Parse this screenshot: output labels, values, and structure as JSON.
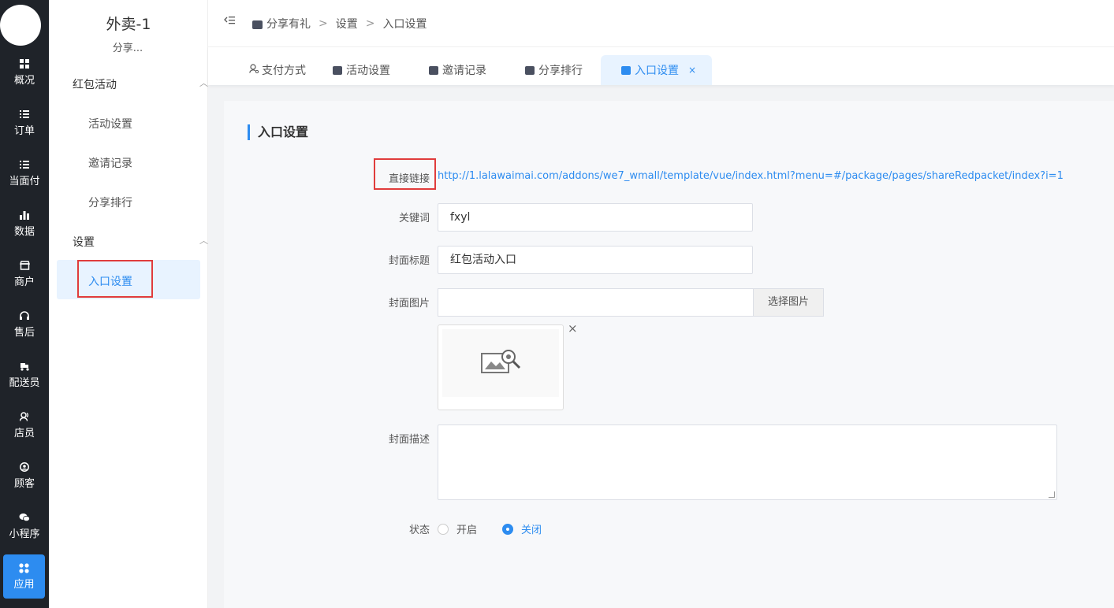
{
  "rail": {
    "items": [
      {
        "label": "概况",
        "icon": "dashboard-icon"
      },
      {
        "label": "订单",
        "icon": "list-icon"
      },
      {
        "label": "当面付",
        "icon": "list-icon"
      },
      {
        "label": "数据",
        "icon": "bar-chart-icon"
      },
      {
        "label": "商户",
        "icon": "store-icon"
      },
      {
        "label": "售后",
        "icon": "headset-icon"
      },
      {
        "label": "配送员",
        "icon": "delivery-icon"
      },
      {
        "label": "店员",
        "icon": "staff-icon"
      },
      {
        "label": "顾客",
        "icon": "customer-icon"
      },
      {
        "label": "小程序",
        "icon": "wechat-icon"
      },
      {
        "label": "应用",
        "icon": "apps-icon"
      }
    ],
    "active": "应用"
  },
  "subnav": {
    "store_name": "外卖-1",
    "store_sub": "分享...",
    "groups": [
      {
        "label": "红包活动",
        "items": [
          "活动设置",
          "邀请记录",
          "分享排行"
        ]
      },
      {
        "label": "设置",
        "items": [
          "入口设置"
        ]
      }
    ],
    "active_item": "入口设置"
  },
  "breadcrumb": [
    "分享有礼",
    "设置",
    "入口设置"
  ],
  "tabs": [
    {
      "label": "支付方式"
    },
    {
      "label": "活动设置"
    },
    {
      "label": "邀请记录"
    },
    {
      "label": "分享排行"
    },
    {
      "label": "入口设置",
      "active": true,
      "close": "×"
    }
  ],
  "form": {
    "title": "入口设置",
    "direct_link_label": "直接链接",
    "direct_link": "http://1.lalawaimai.com/addons/we7_wmall/template/vue/index.html?menu=#/package/pages/shareRedpacket/index?i=1",
    "keyword_label": "关键词",
    "keyword_value": "fxyl",
    "cover_title_label": "封面标题",
    "cover_title_value": "红包活动入口",
    "cover_image_label": "封面图片",
    "select_image_button": "选择图片",
    "remove_image": "×",
    "cover_desc_label": "封面描述",
    "cover_desc_value": "",
    "status_label": "状态",
    "status_options": [
      "开启",
      "关闭"
    ],
    "status_selected": "关闭"
  },
  "colors": {
    "accent": "#2d8cf0",
    "rail_bg": "#1f2329",
    "highlight": "#e03c3c"
  }
}
